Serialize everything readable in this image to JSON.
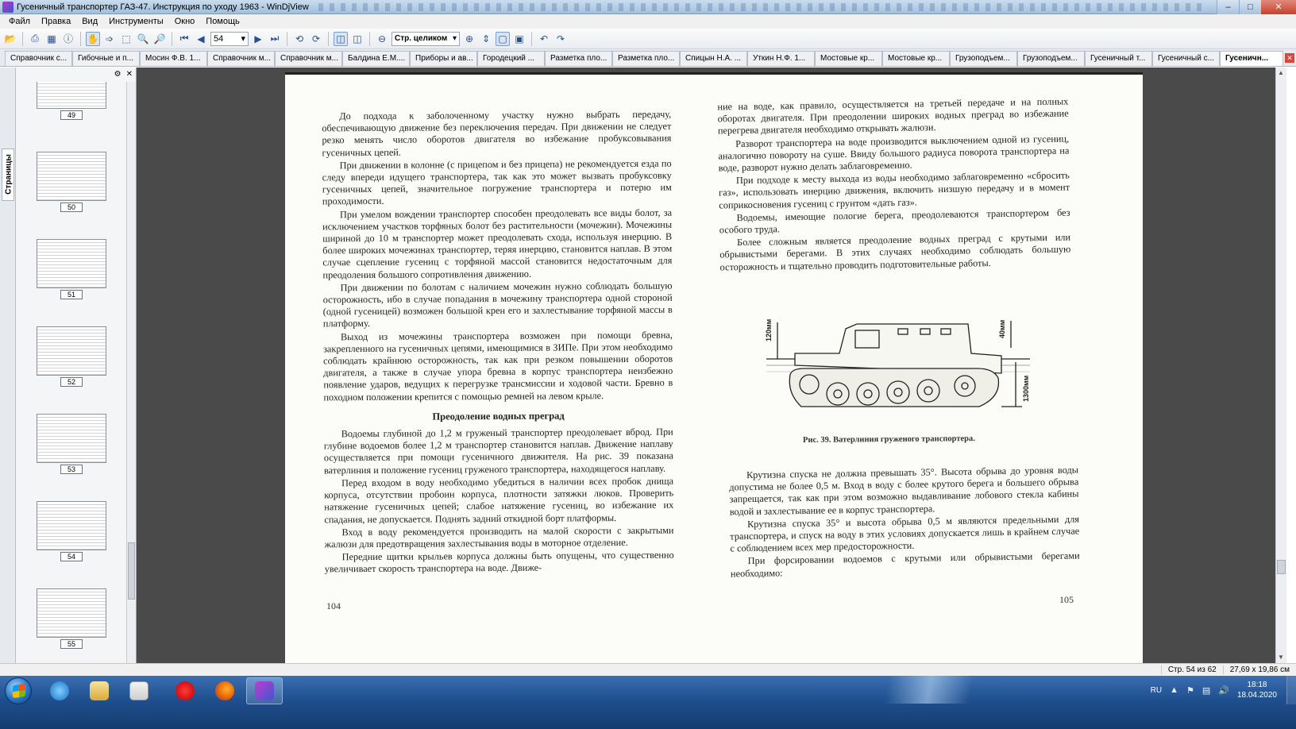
{
  "window": {
    "title": "Гусеничный транспортер ГАЗ-47. Инструкция по уходу 1963 - WinDjView",
    "min_icon": "minimize-icon",
    "max_icon": "maximize-icon",
    "close_icon": "close-icon"
  },
  "menu": [
    "Файл",
    "Правка",
    "Вид",
    "Инструменты",
    "Окно",
    "Помощь"
  ],
  "toolbar": {
    "page_value": "54",
    "zoom_value": "Стр. целиком"
  },
  "tabs": [
    "Справочник с...",
    "Гибочные и п...",
    "Мосин Ф.В. 1...",
    "Справочник м...",
    "Справочник м...",
    "Балдина Е.М....",
    "Приборы и ав...",
    "Городецкий ...",
    "Разметка пло...",
    "Разметка пло...",
    "Спицын Н.А. ...",
    "Уткин Н.Ф. 1...",
    "Мостовые кр...",
    "Мостовые кр...",
    "Грузоподъем...",
    "Грузоподъем...",
    "Гусеничный т...",
    "Гусеничный с...",
    "Гусеничн..."
  ],
  "side_panel": {
    "vertical_tab": "Страницы",
    "thumbnails": [
      "49",
      "50",
      "51",
      "52",
      "53",
      "54",
      "55"
    ]
  },
  "document": {
    "left_paragraphs": [
      "До подхода к заболоченному участку нужно выбрать передачу, обеспечивающую движение без переключения передач. При движении не следует резко менять число оборотов двигателя во избежание пробуксовывания гусеничных цепей.",
      "При движении в колонне (с прицепом и без прицепа) не рекомендуется езда по следу впереди идущего транспортера, так как это может вызвать пробуксовку гусеничных цепей, значительное погружение транспортера и потерю им проходимости.",
      "При умелом вождении транспортер способен преодолевать все виды болот, за исключением участков торфяных болот без растительности (мочежин). Мочежины шириной до 10 м транспортер может преодолевать схода, используя инерцию. В более широких мочежинах транспортер, теряя инерцию, становится наплав. В этом случае сцепление гусениц с торфяной массой становится недостаточным для преодоления большого сопротивления движению.",
      "При движении по болотам с наличием мочежин нужно соблюдать большую осторожность, ибо в случае попадания в мочежину транспортера одной стороной (одной гусеницей) возможен большой крен его и захлестывание торфяной массы в платформу.",
      "Выход из мочежины транспортера возможен при помощи бревна, закрепленного на гусеничных цепями, имеющимися в ЗИПе. При этом необходимо соблюдать крайнюю осторожность, так как при резком повышении оборотов двигателя, а также в случае упора бревна в корпус транспортера неизбежно появление ударов, ведущих к перегрузке трансмиссии и ходовой части. Бревно в походном положении крепится с помощью ремней на левом крыле."
    ],
    "heading": "Преодоление водных преград",
    "left_paragraphs_2": [
      "Водоемы глубиной до 1,2 м груженый транспортер преодолевает вброд. При глубине водоемов более 1,2 м транспортер становится наплав. Движение наплаву осуществляется при помощи гусеничного движителя. На рис. 39 показана ватерлиния и положение гусениц груженого транспортера, находящегося наплаву.",
      "Перед входом в воду необходимо убедиться в наличии всех пробок днища корпуса, отсутствии пробоин корпуса, плотности затяжки люков. Проверить натяжение гусеничных цепей; слабое натяжение гусениц, во избежание их спадания, не допускается. Поднять задний откидной борт платформы.",
      "Вход в воду рекомендуется производить на малой скорости с закрытыми жалюзи для предотвращения захлестывания воды в моторное отделение.",
      "Передние щитки крыльев корпуса должны быть опущены, что существенно увеличивает скорость транспортера на воде. Движе-"
    ],
    "left_page_number": "104",
    "right_paragraphs": [
      "ние на воде, как правило, осуществляется на третьей передаче и на полных оборотах двигателя. При преодолении широких водных преград во избежание перегрева двигателя необходимо открывать жалюзи.",
      "Разворот транспортера на воде производится выключением одной из гусениц, аналогично повороту на суше. Ввиду большого радиуса поворота транспортера на воде, разворот нужно делать заблаговременно.",
      "При подходе к месту выхода из воды необходимо заблаговременно «сбросить газ», использовать инерцию движения, включить низшую передачу и в момент соприкосновения гусениц с грунтом «дать газ».",
      "Водоемы, имеющие пологие берега, преодолеваются транспортером без особого труда.",
      "Более сложным является преодоление водных преград с крутыми или обрывистыми берегами. В этих случаях необходимо соблюдать большую осторожность и тщательно проводить подготовительные работы."
    ],
    "figure": {
      "dim_left": "120мм",
      "dim_right_top": "40мм",
      "dim_right": "1300мм",
      "caption": "Рис. 39. Ватерлиния груженого транспортера."
    },
    "right_paragraphs_2": [
      "Крутизна спуска не должна превышать 35°. Высота обрыва до уровня воды допустима не более 0,5 м. Вход в воду с более крутого берега и большего обрыва запрещается, так как при этом возможно выдавливание лобового стекла кабины водой и захлестывание ее в корпус транспортера.",
      "Крутизна спуска 35° и высота обрыва 0,5 м являются предельными для транспортера, и спуск на воду в этих условиях допускается лишь в крайнем случае с соблюдением всех мер предосторожности.",
      "При форсировании водоемов с крутыми или обрывистыми берегами необходимо:"
    ],
    "right_page_number": "105"
  },
  "status": {
    "page_info": "Стр. 54 из 62",
    "page_size": "27,69 x 19,86 см"
  },
  "taskbar": {
    "language": "RU",
    "time": "18:18",
    "date": "18.04.2020"
  }
}
